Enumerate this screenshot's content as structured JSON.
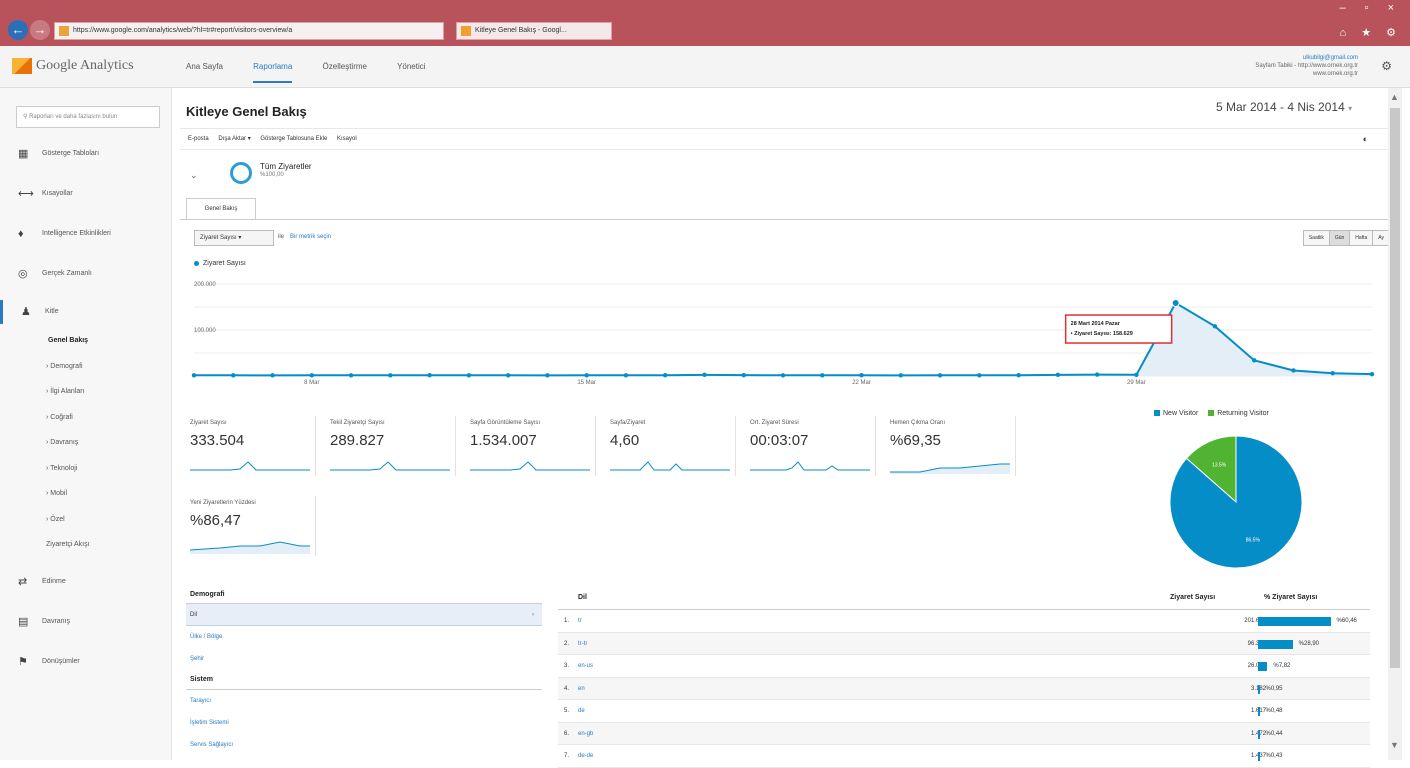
{
  "browser": {
    "url": "https://www.google.com/analytics/web/?hl=tr#report/visitors-overview/a",
    "tab_title": "Kitleye Genel Bakış - Googl...",
    "window_controls": "– ▫ ×",
    "toolbar_icons": "⌂ ★ ⚙"
  },
  "ga_header": {
    "logo": "Google Analytics",
    "nav": [
      "Ana Sayfa",
      "Raporlama",
      "Özelleştirme",
      "Yönetici"
    ],
    "account_email": "ulkubilgi@gmail.com",
    "account_site": "Sayfam Tabiki - http://www.ornek.org.tr",
    "account_view": "www.ornek.org.tr"
  },
  "sidebar": {
    "search_placeholder": "Raporları ve daha fazlasını bulun",
    "items": [
      {
        "icon": "dashboard-icon",
        "glyph": "▦",
        "label": "Gösterge Tabloları"
      },
      {
        "icon": "shortcuts-icon",
        "glyph": "⟷",
        "label": "Kısayollar"
      },
      {
        "icon": "intelligence-icon",
        "glyph": "♦",
        "label": "Intelligence Etkinlikleri"
      },
      {
        "icon": "realtime-icon",
        "glyph": "◎",
        "label": "Gerçek Zamanlı"
      },
      {
        "icon": "audience-icon",
        "glyph": "♟",
        "label": "Kitle"
      },
      {
        "icon": "acquisition-icon",
        "glyph": "⇄",
        "label": "Edinme"
      },
      {
        "icon": "behavior-icon",
        "glyph": "▤",
        "label": "Davranış"
      },
      {
        "icon": "conversions-icon",
        "glyph": "⚑",
        "label": "Dönüşümler"
      }
    ],
    "audience_sub": [
      "Genel Bakış",
      "› Demografi",
      "› İlgi Alanları",
      "› Coğrafi",
      "› Davranış",
      "› Teknoloji",
      "› Mobil",
      "› Özel",
      "Ziyaretçi Akışı"
    ]
  },
  "report": {
    "title": "Kitleye Genel Bakış",
    "date_range": "5 Mar 2014 - 4 Nis 2014",
    "actions": [
      "E-posta",
      "Dışa Aktar ▾",
      "Gösterge Tablosuna Ekle",
      "Kısayol"
    ],
    "segment_name": "Tüm Ziyaretler",
    "segment_pct": "%100,00",
    "subtab": "Genel Bakış",
    "metric_select": "Ziyaret Sayısı ▾",
    "vs_text": "ile",
    "vs_link": "Bir metrik seçin",
    "granularity": [
      "Saatlik",
      "Gün",
      "Hafta",
      "Ay"
    ],
    "granularity_active": "Gün",
    "legend": "Ziyaret Sayısı"
  },
  "chart_data": {
    "type": "line",
    "series": [
      {
        "name": "Ziyaret Sayısı",
        "color": "#058dc7",
        "values": [
          1500,
          1600,
          1400,
          1500,
          1600,
          1500,
          1700,
          1600,
          1500,
          1400,
          1500,
          1600,
          1700,
          2500,
          1800,
          1600,
          1500,
          1700,
          1400,
          1500,
          1600,
          1700,
          2500,
          3000,
          2600,
          158629,
          108000,
          34000,
          12000,
          6000,
          4000
        ]
      }
    ],
    "y_ticks": [
      "200.000",
      "100.000"
    ],
    "ylim": [
      0,
      200000
    ],
    "x_ticks": [
      "8 Mar",
      "15 Mar",
      "22 Mar",
      "29 Mar"
    ],
    "tooltip_date": "28 Mart 2014 Pazar",
    "tooltip_value": "• Ziyaret Sayısı: 158.629"
  },
  "metrics": [
    {
      "label": "Ziyaret Sayısı",
      "value": "333.504"
    },
    {
      "label": "Tekil Ziyaretçi Sayısı",
      "value": "289.827"
    },
    {
      "label": "Sayfa Görüntüleme Sayısı",
      "value": "1.534.007"
    },
    {
      "label": "Sayfa/Ziyaret",
      "value": "4,60"
    },
    {
      "label": "Ort. Ziyaret Süresi",
      "value": "00:03:07"
    },
    {
      "label": "Hemen Çıkma Oranı",
      "value": "%69,35"
    },
    {
      "label": "Yeni Ziyaretlerin Yüzdesi",
      "value": "%86,47"
    }
  ],
  "pie": {
    "legend": [
      "New Visitor",
      "Returning Visitor"
    ],
    "colors": [
      "#058dc7",
      "#50b432"
    ],
    "values": [
      86.5,
      13.5
    ],
    "labels": [
      "86.5%",
      "13.5%"
    ]
  },
  "left_table": {
    "section1": "Demografi",
    "rows1": [
      "Dil",
      "Ülke / Bölge",
      "Şehir"
    ],
    "section2": "Sistem",
    "rows2": [
      "Tarayıcı",
      "İşletim Sistemi",
      "Servis Sağlayıcı"
    ]
  },
  "right_table": {
    "header_dim": "Dil",
    "header_val": "Ziyaret Sayısı",
    "header_pct": "% Ziyaret Sayısı",
    "rows": [
      {
        "idx": "1.",
        "lang": "tr",
        "value": "201.644",
        "pct": "%60,46",
        "frac": 0.6046
      },
      {
        "idx": "2.",
        "lang": "tr-tr",
        "value": "96.378",
        "pct": "%28,90",
        "frac": 0.289
      },
      {
        "idx": "3.",
        "lang": "en-us",
        "value": "26.078",
        "pct": "%7,82",
        "frac": 0.0782
      },
      {
        "idx": "4.",
        "lang": "en",
        "value": "3.182",
        "pct": "%0,95",
        "frac": 0.0095
      },
      {
        "idx": "5.",
        "lang": "de",
        "value": "1.617",
        "pct": "%0,48",
        "frac": 0.0048
      },
      {
        "idx": "6.",
        "lang": "en-gb",
        "value": "1.472",
        "pct": "%0,44",
        "frac": 0.0044
      },
      {
        "idx": "7.",
        "lang": "de-de",
        "value": "1.437",
        "pct": "%0,43",
        "frac": 0.0043
      }
    ]
  }
}
